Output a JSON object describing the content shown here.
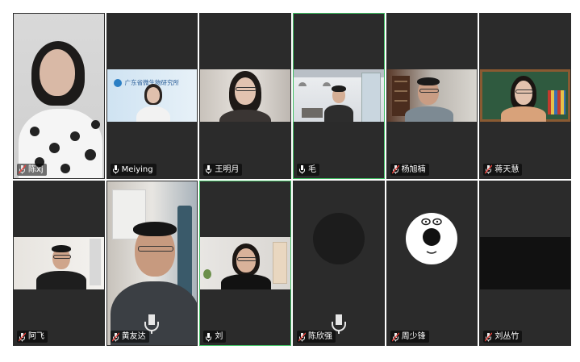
{
  "participants": [
    {
      "name": "陈xj"
    },
    {
      "name": "Meiying"
    },
    {
      "name": "王明月"
    },
    {
      "name": "毛"
    },
    {
      "name": "杨旭楠"
    },
    {
      "name": "蒋天慧"
    },
    {
      "name": "阿飞"
    },
    {
      "name": "黄友达"
    },
    {
      "name": "刘"
    },
    {
      "name": "陈欣强"
    },
    {
      "name": "周少锋"
    },
    {
      "name": "刘丛竹"
    }
  ],
  "backdrop_text": "广东省微生物研究所",
  "colors": {
    "tile_bg": "#2b2b2b",
    "active_border": "#3fbf63",
    "label_bg": "rgba(0,0,0,0.55)"
  },
  "icons": {
    "mic": "microphone-icon",
    "mic_muted": "microphone-muted-icon"
  }
}
